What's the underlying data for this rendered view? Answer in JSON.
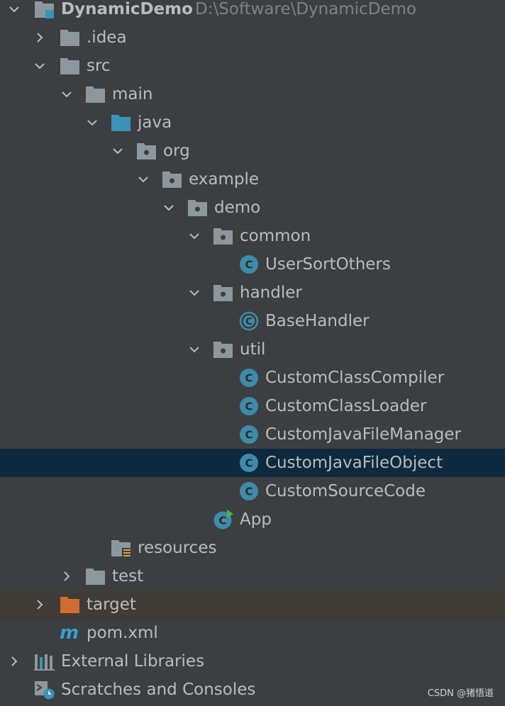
{
  "project": {
    "name": "DynamicDemo",
    "path": "D:\\Software\\DynamicDemo"
  },
  "tree": {
    "idea": ".idea",
    "src": "src",
    "main": "main",
    "java": "java",
    "org": "org",
    "example": "example",
    "demo": "demo",
    "common": "common",
    "user_sort_others": "UserSortOthers",
    "handler": "handler",
    "base_handler": "BaseHandler",
    "util": "util",
    "custom_class_compiler": "CustomClassCompiler",
    "custom_class_loader": "CustomClassLoader",
    "custom_java_file_manager": "CustomJavaFileManager",
    "custom_java_file_object": "CustomJavaFileObject",
    "custom_source_code": "CustomSourceCode",
    "app": "App",
    "resources": "resources",
    "test": "test",
    "target": "target",
    "pom": "pom.xml",
    "external_libraries": "External Libraries",
    "scratches": "Scratches and Consoles"
  },
  "watermark": "CSDN @猪悟道",
  "colors": {
    "background": "#3c3f41",
    "selected_row": "#0d293e",
    "excluded_row": "#3f3b36",
    "text": "#bbbbbb",
    "folder": "#8d979e",
    "source_folder": "#3b93b8",
    "excluded_folder": "#d06c33",
    "class_icon": "#3f8aa8",
    "maven_icon": "#3d9ccf"
  },
  "icons": [
    "project-folder-icon",
    "folder-icon",
    "source-folder-icon",
    "package-icon",
    "class-icon",
    "abstract-class-icon",
    "main-class-icon",
    "resources-folder-icon",
    "excluded-folder-icon",
    "maven-icon",
    "libraries-icon",
    "scratches-icon",
    "chevron-down-icon",
    "chevron-right-icon"
  ]
}
